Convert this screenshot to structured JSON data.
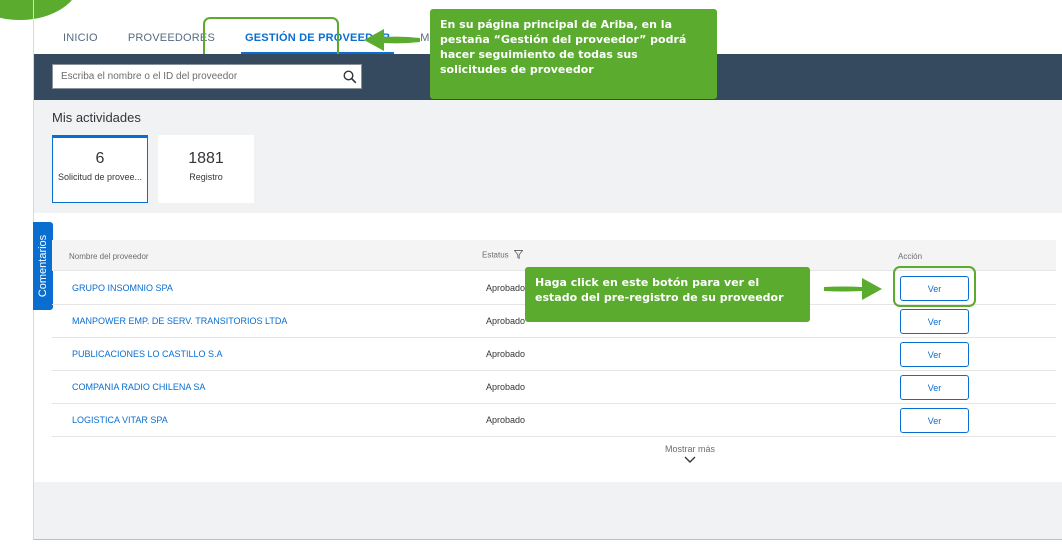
{
  "nav": {
    "tabs": [
      {
        "label": "INICIO"
      },
      {
        "label": "PROVEEDORES"
      },
      {
        "label": "GESTIÓN DE PROVEEDOR"
      },
      {
        "label": "M"
      }
    ]
  },
  "search": {
    "placeholder": "Escriba el nombre o el ID del proveedor",
    "icon": "search-icon"
  },
  "activities": {
    "title": "Mis actividades",
    "tiles": [
      {
        "count": "6",
        "label": "Solicitud de provee..."
      },
      {
        "count": "1881",
        "label": "Registro"
      }
    ]
  },
  "feedback": {
    "label": "Comentarios"
  },
  "table": {
    "headers": {
      "name": "Nombre del proveedor",
      "status": "Estatus",
      "action": "Acción"
    },
    "rows": [
      {
        "name": "GRUPO INSOMNIO SPA",
        "status": "Aprobado",
        "action": "Ver"
      },
      {
        "name": "MANPOWER EMP. DE SERV. TRANSITORIOS LTDA",
        "status": "Aprobado",
        "action": "Ver"
      },
      {
        "name": "PUBLICACIONES LO CASTILLO S.A",
        "status": "Aprobado",
        "action": "Ver"
      },
      {
        "name": "COMPANIA RADIO CHILENA SA",
        "status": "Aprobado",
        "action": "Ver"
      },
      {
        "name": "LOGISTICA VITAR SPA",
        "status": "Aprobado",
        "action": "Ver"
      }
    ],
    "show_more": "Mostrar más"
  },
  "callouts": {
    "tab": "En su página principal de Ariba, en la pestaña “Gestión del proveedor” podrá hacer seguimiento de todas sus solicitudes de proveedor",
    "button": "Haga click en este botón para ver el estado del pre-registro de su proveedor"
  },
  "colors": {
    "accent": "#0a6ed1",
    "callout": "#5aab2e",
    "shell": "#354a5f"
  }
}
